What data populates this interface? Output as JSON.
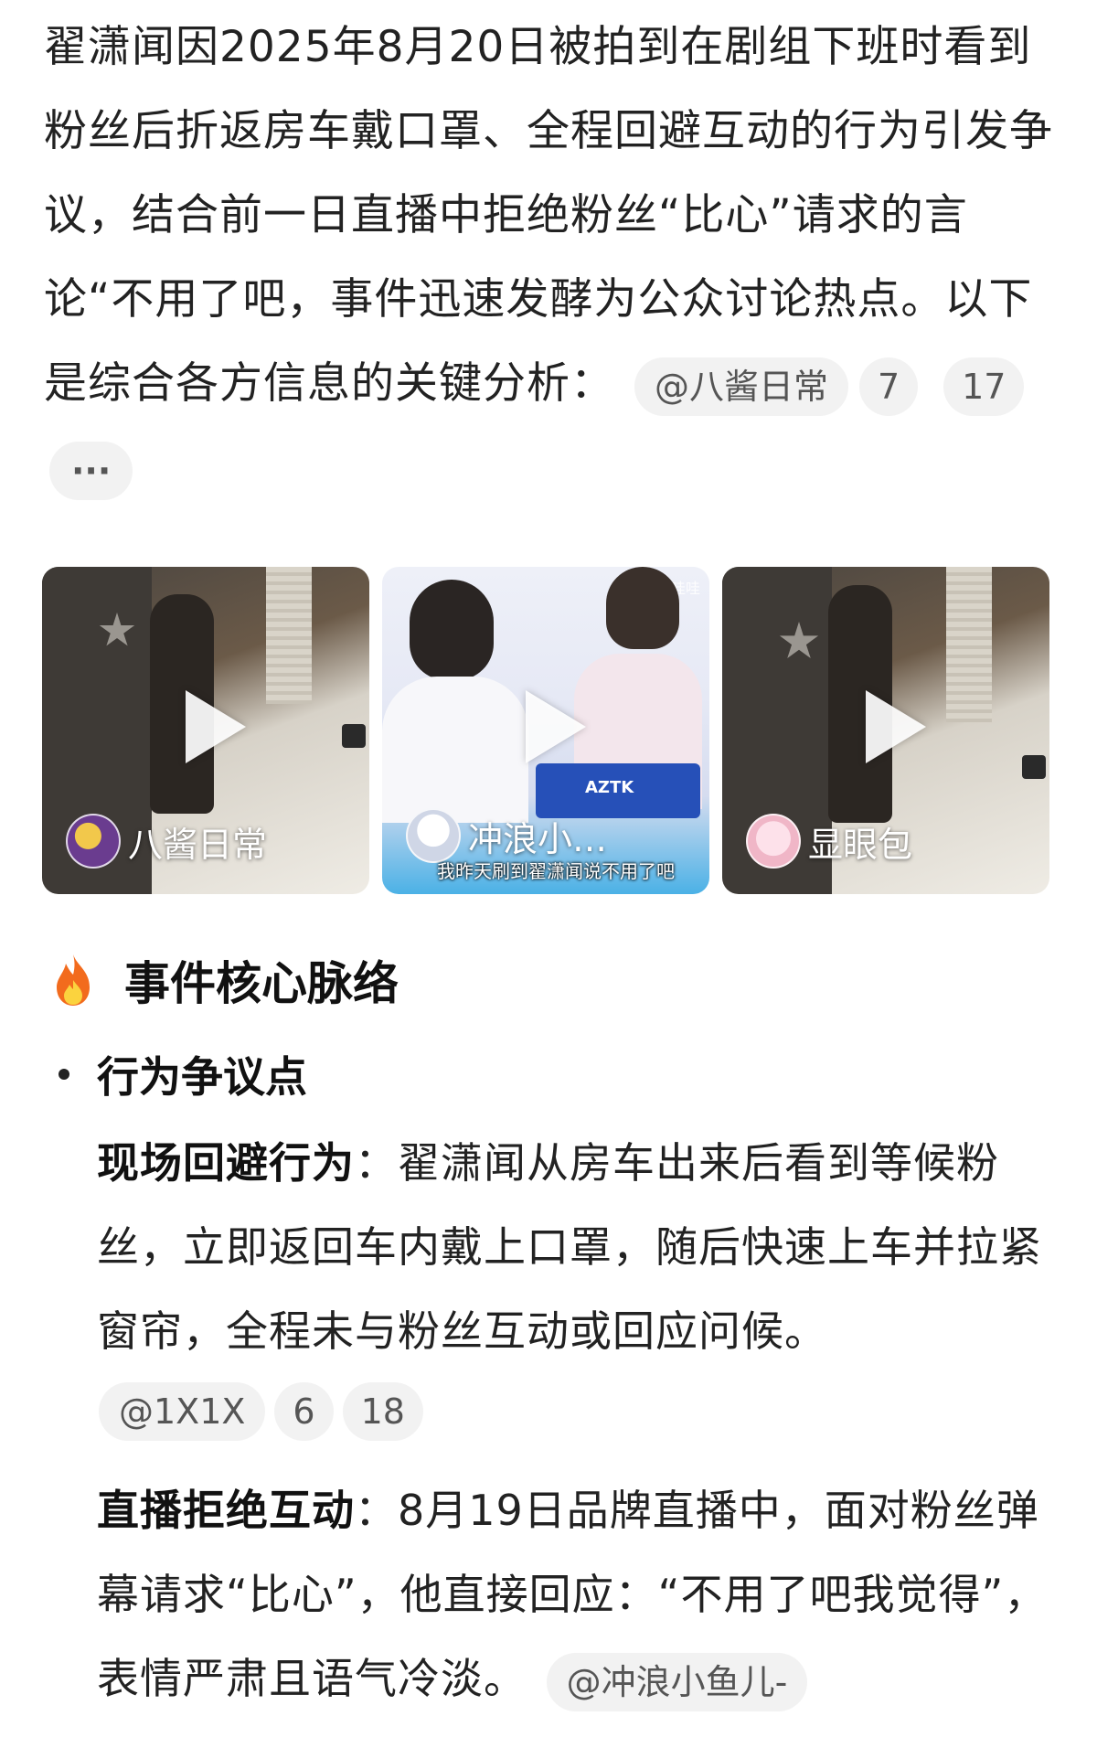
{
  "intro": {
    "text": "翟潇闻因2025年8月20日被拍到在剧组下班时看到粉丝后折返房车戴口罩、全程回避互动的行为引发争议，结合前一日直播中拒绝粉丝“比心”请求的言论“不用了吧，事件迅速发酵为公众讨论热点。以下是综合各方信息的关键分析：",
    "source_chip": "@八酱日常",
    "num_chip_1": "7",
    "num_chip_2": "17",
    "more_chip": "···"
  },
  "videos": [
    {
      "author": "八酱日常",
      "subtitle": "",
      "watermark": ""
    },
    {
      "author": "冲浪小…",
      "subtitle": "我昨天刷到翟潇闻说不用了吧",
      "watermark": "哇哇"
    },
    {
      "author": "显眼包",
      "subtitle": "",
      "watermark": ""
    }
  ],
  "video2_banner": "AZTK",
  "section": {
    "title": "事件核心脉络",
    "icon": "fire-icon"
  },
  "bullet": {
    "title": "行为争议点"
  },
  "point1": {
    "label": "现场回避行为",
    "text": "：翟潇闻从房车出来后看到等候粉丝，立即返回车内戴上口罩，随后快速上车并拉紧窗帘，全程未与粉丝互动或回应问候。",
    "source_chip": "@1X1X",
    "num_chip_1": "6",
    "num_chip_2": "18"
  },
  "point2": {
    "label": "直播拒绝互动",
    "text": "：8月19日品牌直播中，面对粉丝弹幕请求“比心”，他直接回应：“不用了吧我觉得”，表情严肃且语气冷淡。",
    "source_chip": "@冲浪小鱼儿-"
  }
}
